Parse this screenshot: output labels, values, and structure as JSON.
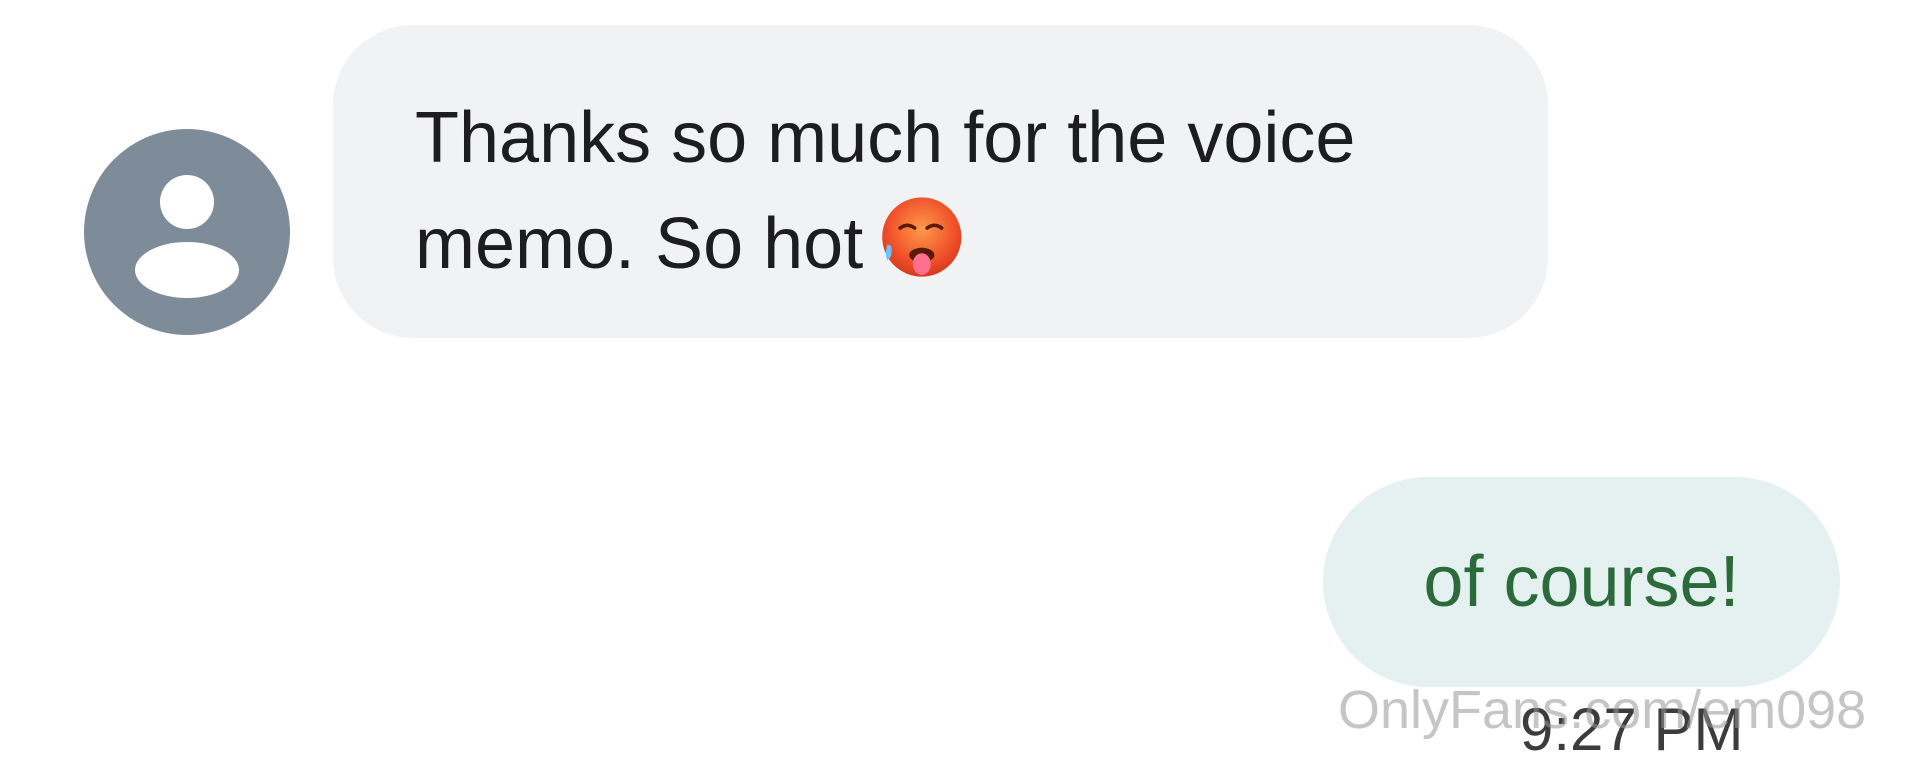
{
  "conversation": {
    "incoming": {
      "lines": [
        "Thanks so much for the voice",
        "memo. So hot"
      ],
      "emoji": "hot-face-emoji"
    },
    "outgoing": {
      "text": "of course!"
    },
    "timestamp": "9:27 PM"
  },
  "watermark": "OnlyFans.com/em098",
  "colors": {
    "avatar_bg": "#7d8c98",
    "incoming_bubble": "#f1f2f4",
    "outgoing_bubble": "#e5f1f1",
    "outgoing_text": "#2b6a3a"
  },
  "icons": {
    "avatar": "person-icon"
  }
}
